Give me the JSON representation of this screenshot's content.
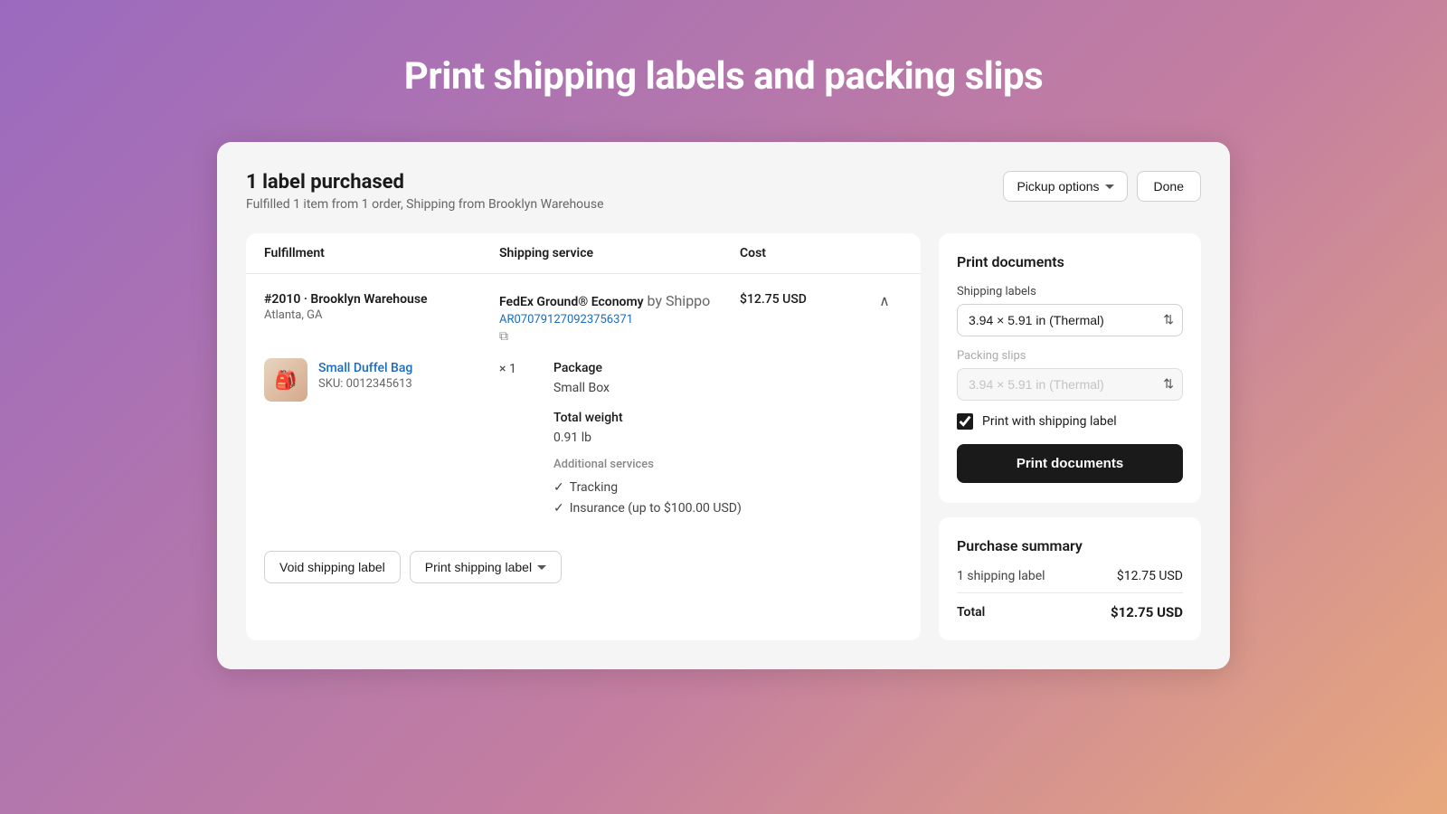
{
  "page": {
    "title": "Print shipping labels and packing slips",
    "background": "linear-gradient(135deg, #9b6abf 0%, #c47fa0 60%, #e8a87c 100%)"
  },
  "header": {
    "labels_purchased": "1 label purchased",
    "subtitle": "Fulfilled 1 item from 1 order, Shipping from Brooklyn Warehouse",
    "pickup_options_label": "Pickup options",
    "done_label": "Done"
  },
  "table": {
    "columns": [
      "Fulfillment",
      "Shipping service",
      "Cost",
      ""
    ],
    "row": {
      "fulfillment_id": "#2010 · Brooklyn Warehouse",
      "location": "Atlanta, GA",
      "shipping_service": "FedEx Ground® Economy",
      "shipping_by": "by Shippo",
      "tracking_number": "AR070791270923756371",
      "cost": "$12.75 USD",
      "item_name": "Small Duffel Bag",
      "item_sku": "SKU: 0012345613",
      "item_qty": "× 1",
      "package_label": "Package",
      "package_value": "Small Box",
      "weight_label": "Total weight",
      "weight_value": "0.91 lb",
      "additional_services_label": "Additional services",
      "services": [
        "Tracking",
        "Insurance (up to $100.00 USD)"
      ],
      "void_label": "Void shipping label",
      "print_label": "Print shipping label"
    }
  },
  "print_documents": {
    "title": "Print documents",
    "shipping_labels_label": "Shipping labels",
    "shipping_labels_value": "3.94 × 5.91 in (Thermal)",
    "packing_slips_label": "Packing slips",
    "packing_slips_value": "3.94 × 5.91 in (Thermal)",
    "checkbox_label": "Print with shipping label",
    "checkbox_checked": true,
    "print_button_label": "Print documents"
  },
  "purchase_summary": {
    "title": "Purchase summary",
    "items": [
      {
        "label": "1 shipping label",
        "value": "$12.75 USD"
      }
    ],
    "total_label": "Total",
    "total_value": "$12.75 USD"
  }
}
